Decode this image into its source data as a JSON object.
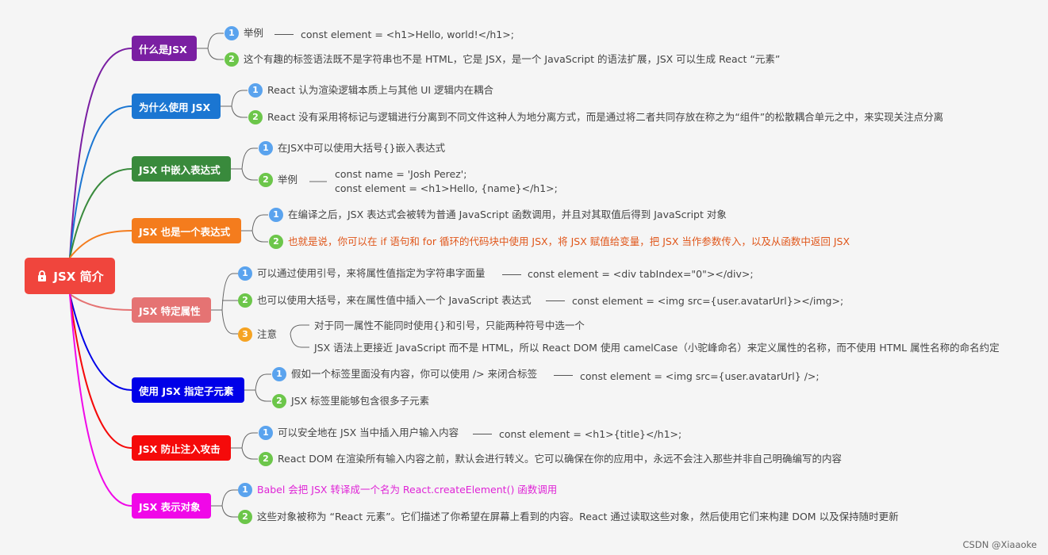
{
  "root": {
    "label": "JSX 简介",
    "icon": "lock-icon"
  },
  "topics": [
    {
      "label": "什么是JSX",
      "color": "#7a1fa2"
    },
    {
      "label": "为什么使用 JSX",
      "color": "#1b76d2"
    },
    {
      "label": "JSX 中嵌入表达式",
      "color": "#398a3c"
    },
    {
      "label": "JSX 也是一个表达式",
      "color": "#f47c1d"
    },
    {
      "label": "JSX 特定属性",
      "color": "#e57373"
    },
    {
      "label": "使用 JSX 指定子元素",
      "color": "#0000e8"
    },
    {
      "label": "JSX 防止注入攻击",
      "color": "#f50a0a"
    },
    {
      "label": "JSX 表示对象",
      "color": "#f008e8"
    }
  ],
  "t0": {
    "c1": {
      "num": "1",
      "text": "举例",
      "code": "const element = <h1>Hello, world!</h1>;"
    },
    "c2": {
      "num": "2",
      "text": "这个有趣的标签语法既不是字符串也不是 HTML，它是 JSX，是一个 JavaScript 的语法扩展，JSX 可以生成 React “元素”"
    }
  },
  "t1": {
    "c1": {
      "num": "1",
      "text": "React 认为渲染逻辑本质上与其他 UI 逻辑内在耦合"
    },
    "c2": {
      "num": "2",
      "text": "React 没有采用将标记与逻辑进行分离到不同文件这种人为地分离方式，而是通过将二者共同存放在称之为“组件”的松散耦合单元之中，来实现关注点分离"
    }
  },
  "t2": {
    "c1": {
      "num": "1",
      "text": "在JSX中可以使用大括号{}嵌入表达式"
    },
    "c2": {
      "num": "2",
      "text": "举例",
      "code1": "const name = 'Josh Perez';",
      "code2": "const element = <h1>Hello, {name}</h1>;"
    }
  },
  "t3": {
    "c1": {
      "num": "1",
      "text": "在编译之后，JSX 表达式会被转为普通 JavaScript 函数调用，并且对其取值后得到 JavaScript 对象"
    },
    "c2": {
      "num": "2",
      "text": "也就是说，你可以在 if 语句和 for 循环的代码块中使用 JSX，将 JSX 赋值给变量，把 JSX 当作参数传入，以及从函数中返回 JSX"
    }
  },
  "t4": {
    "c1": {
      "num": "1",
      "text": "可以通过使用引号，来将属性值指定为字符串字面量",
      "code": "const element = <div tabIndex=\"0\"></div>;"
    },
    "c2": {
      "num": "2",
      "text": "也可以使用大括号，来在属性值中插入一个 JavaScript 表达式",
      "code": "const element = <img src={user.avatarUrl}></img>;"
    },
    "c3": {
      "num": "3",
      "text": "注意",
      "sub1": "对于同一属性不能同时使用{}和引号，只能两种符号中选一个",
      "sub2": "JSX 语法上更接近 JavaScript 而不是 HTML，所以 React DOM 使用 camelCase（小驼峰命名）来定义属性的名称，而不使用 HTML 属性名称的命名约定"
    }
  },
  "t5": {
    "c1": {
      "num": "1",
      "text": "假如一个标签里面没有内容，你可以使用 /> 来闭合标签",
      "code": "const element = <img src={user.avatarUrl} />;"
    },
    "c2": {
      "num": "2",
      "text": "JSX 标签里能够包含很多子元素"
    }
  },
  "t6": {
    "c1": {
      "num": "1",
      "text": "可以安全地在 JSX 当中插入用户输入内容",
      "code": "const element = <h1>{title}</h1>;"
    },
    "c2": {
      "num": "2",
      "text": "React DOM 在渲染所有输入内容之前，默认会进行转义。它可以确保在你的应用中，永远不会注入那些并非自己明确编写的内容"
    }
  },
  "t7": {
    "c1": {
      "num": "1",
      "text": "Babel 会把 JSX 转译成一个名为 React.createElement() 函数调用"
    },
    "c2": {
      "num": "2",
      "text": "这些对象被称为 “React 元素”。它们描述了你希望在屏幕上看到的内容。React 通过读取这些对象，然后使用它们来构建 DOM 以及保持随时更新"
    }
  },
  "watermark": "CSDN @Xiaaoke"
}
